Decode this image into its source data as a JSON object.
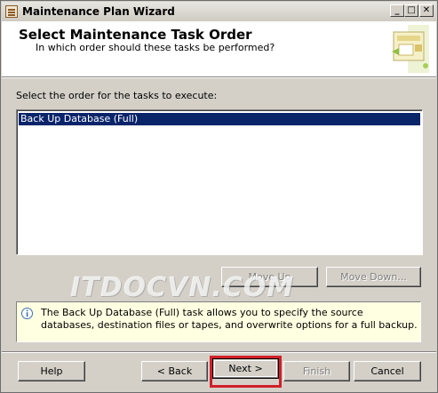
{
  "window": {
    "title": "Maintenance Plan Wizard",
    "controls": {
      "minimize": "_",
      "maximize": "□",
      "close": "✕"
    }
  },
  "header": {
    "title": "Select Maintenance Task Order",
    "subtitle": "In which order should these tasks be performed?"
  },
  "list": {
    "label": "Select the order for the tasks to execute:",
    "items": [
      "Back Up Database (Full)"
    ],
    "selected_index": 0
  },
  "order_buttons": {
    "move_up": "Move Up",
    "move_down": "Move Down..."
  },
  "watermark": "ITDOCVN.COM",
  "info": {
    "icon": "info-icon",
    "text": "The Back Up Database (Full) task allows you to specify the source databases, destination files or tapes, and overwrite options for a full backup."
  },
  "footer": {
    "help": "Help",
    "back": "< Back",
    "next": "Next >",
    "finish": "Finish",
    "cancel": "Cancel"
  },
  "colors": {
    "selection": "#0a246a",
    "info_background": "#ffffe1",
    "highlight_border": "#d21f2b",
    "dialog_background": "#d4d0c8"
  }
}
